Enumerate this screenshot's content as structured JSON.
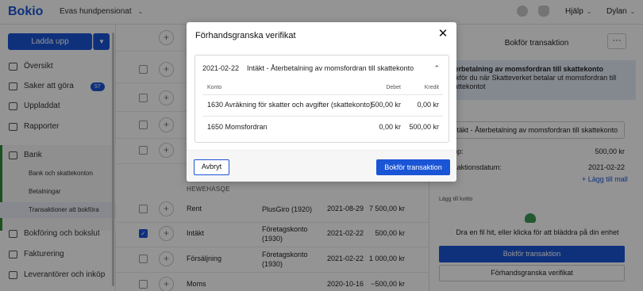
{
  "topbar": {
    "logo": "Bokio",
    "company": "Evas hundpensionat",
    "help_label": "Hjälp",
    "user_label": "Dylan"
  },
  "sidebar": {
    "upload_label": "Ladda upp",
    "items": [
      {
        "label": "Översikt",
        "icon": "home-icon"
      },
      {
        "label": "Saker att göra",
        "icon": "calendar-icon",
        "badge": "57"
      },
      {
        "label": "Uppladdat",
        "icon": "folder-icon"
      },
      {
        "label": "Rapporter",
        "icon": "chart-icon"
      },
      {
        "label": "Bank",
        "icon": "bank-icon"
      },
      {
        "label": "Bokföring och bokslut",
        "icon": "book-icon"
      },
      {
        "label": "Fakturering",
        "icon": "invoice-icon"
      },
      {
        "label": "Leverantörer och inköp",
        "icon": "cart-icon"
      }
    ],
    "bank_sub": [
      "Bank och skattekonton",
      "Betalningar",
      "Transaktioner att bokföra"
    ]
  },
  "list": {
    "section_header": "HEWEHASQE",
    "rows": [
      {
        "checked": false,
        "desc": "Rent",
        "account": "PlusGiro (1920)",
        "date": "2021-08-29",
        "amount": "7 500,00 kr"
      },
      {
        "checked": true,
        "desc": "Intäkt",
        "account": "Företagskonto (1930)",
        "date": "2021-02-22",
        "amount": "500,00 kr"
      },
      {
        "checked": false,
        "desc": "Försäljning",
        "account": "Företagskonto (1930)",
        "date": "2021-02-22",
        "amount": "1 000,00 kr"
      },
      {
        "checked": false,
        "desc": "Moms",
        "account": "",
        "date": "2020-10-16",
        "amount": "−500,00 kr"
      }
    ]
  },
  "right_panel": {
    "title": "Bokför transaktion",
    "more_label": "···",
    "info_title": "Återbetalning av momsfordran till skattekonto",
    "info_body": "Bokför du när Skatteverket betalar ut momsfordran till skattekontot",
    "template_select": "Intäkt - Återbetalning av momsfordran till skattekonto",
    "amount_label": "Belopp:",
    "amount_value": "500,00 kr",
    "date_label": "Transaktionsdatum:",
    "date_value": "2021-02-22",
    "add_file_link": "+ Lägg till mall",
    "attach_label": "Lägg till kvitto",
    "drop_text": "Dra en fil hit, eller klicka för att bläddra på din enhet",
    "book_button": "Bokför transaktion",
    "preview_button": "Förhandsgranska verifikat"
  },
  "modal": {
    "title": "Förhandsgranska verifikat",
    "close_icon": "close-icon",
    "date": "2021-02-22",
    "header_text": "Intäkt - Återbetalning av momsfordran till skattekonto",
    "columns": {
      "account": "Konto",
      "debit": "Debet",
      "credit": "Kredit"
    },
    "entries": [
      {
        "account": "1630 Avräkning för skatter och avgifter (skattekonto)",
        "debit": "500,00 kr",
        "credit": "0,00 kr"
      },
      {
        "account": "1650 Momsfordran",
        "debit": "0,00 kr",
        "credit": "500,00 kr"
      }
    ],
    "cancel_label": "Avbryt",
    "book_label": "Bokför transaktion"
  },
  "colors": {
    "primary": "#1a55d6",
    "bank_accent": "#2f8a3a",
    "info_bg": "#e4edf9"
  }
}
